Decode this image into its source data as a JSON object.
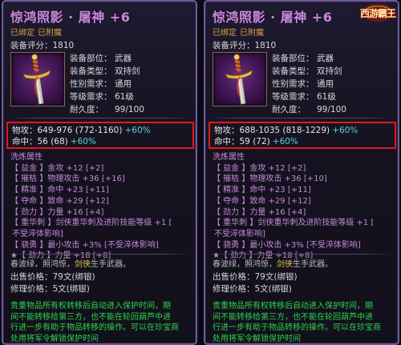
{
  "panels": [
    {
      "title": "惊鸿照影 · 屠神 +6",
      "status": [
        "已绑定",
        "已附魔"
      ],
      "rating_label": "装备评分：",
      "rating_value": "1810",
      "info": [
        {
          "label": "装备部位：",
          "value": "武器"
        },
        {
          "label": "装备类型：",
          "value": "双持剑"
        },
        {
          "label": "性别需求：",
          "value": "通用"
        },
        {
          "label": "等级需求：",
          "value": "61级"
        },
        {
          "label": "耐久度：",
          "value": "99/100"
        }
      ],
      "stats": [
        {
          "text": "物攻：649-976 (772-1160)",
          "bonus": "+60%"
        },
        {
          "text": "命中：56 (68)",
          "bonus": "+60%"
        }
      ],
      "refine_title": "洗炼属性",
      "refine_lines": [
        "【 益金 】金攻 +12 [+2]",
        "【 摧枯 】物理攻击 +36 [+16]",
        "【 精准 】命中 +23 [+11]",
        "【 夺命 】致命 +29 [+12]",
        "【 劲力 】力量 +16 [+4]",
        "【 重华刺 】剑侠重华刺及进阶技能等级 +1 [",
        "不受淬体影响]",
        "【 骁勇 】最小攻击 +3% [不受淬体影响]",
        "★【 劲力 】力量 +18 [+8]"
      ],
      "desc_prefix": "春波绿，照鸿惊，",
      "desc_highlight": "剑侠",
      "desc_suffix": "生手武器。",
      "prices": [
        "出售价格：79文(绑银)",
        "修理价格：5文(绑银)"
      ],
      "note_lines": [
        "贵重物品所有权转移后自动进入保护时间，期",
        "间不能转移给第三方，也不能在轮回葫芦中进",
        "行进一步有助于物品转移的操作。可以在珍宝商",
        "处用将军令解锁保护时间"
      ]
    },
    {
      "title": "惊鸿照影 · 屠神 +6",
      "status": [
        "已绑定",
        "已附魔"
      ],
      "rating_label": "装备评分：",
      "rating_value": "1810",
      "logo_text": "西游霸王",
      "info": [
        {
          "label": "装备部位：",
          "value": "武器"
        },
        {
          "label": "装备类型：",
          "value": "双持剑"
        },
        {
          "label": "性别需求：",
          "value": "通用"
        },
        {
          "label": "等级需求：",
          "value": "61级"
        },
        {
          "label": "耐久度：",
          "value": "99/100"
        }
      ],
      "stats": [
        {
          "text": "物攻：688-1035 (818-1229)",
          "bonus": "+60%"
        },
        {
          "text": "命中：59 (72)",
          "bonus": "+60%"
        }
      ],
      "refine_title": "洗炼属性",
      "refine_lines": [
        "【 益金 】金攻 +12 [+2]",
        "【 摧枯 】物理攻击 +36 [+10]",
        "【 精准 】命中 +23 [+11]",
        "【 夺命 】致命 +29 [+12]",
        "【 劲力 】力量 +16 [+4]",
        "【 重华刺 】剑侠重华刺及进阶技能等级 +1 [",
        "不受淬体影响]",
        "【 骁勇 】最小攻击 +3% [不受淬体影响]",
        "★【 劲力 】力量 +18 [+8]"
      ],
      "desc_prefix": "春波绿，照鸿惊，",
      "desc_highlight": "剑侠",
      "desc_suffix": "生手武器。",
      "prices": [
        "出售价格：79文(绑银)",
        "修理价格：5文(绑银)"
      ],
      "note_lines": [
        "贵重物品所有权转移后自动进入保护时间，期",
        "间不能转移给第三方，也不能在轮回葫芦中进",
        "行进一步有助于物品转移的操作。可以在珍宝商",
        "处用将军令解锁保护时间"
      ]
    }
  ],
  "colors": {
    "title": "#c58ad8",
    "status": "#d7a23f",
    "highlight_box": "#e01a1a",
    "bonus": "#5ad7d4",
    "refine": "#c58ad8",
    "note": "#2fd24a",
    "desc_highlight": "#e2c84a"
  },
  "icons": {
    "item": "sword-hilt-icon",
    "logo": "game-logo"
  }
}
